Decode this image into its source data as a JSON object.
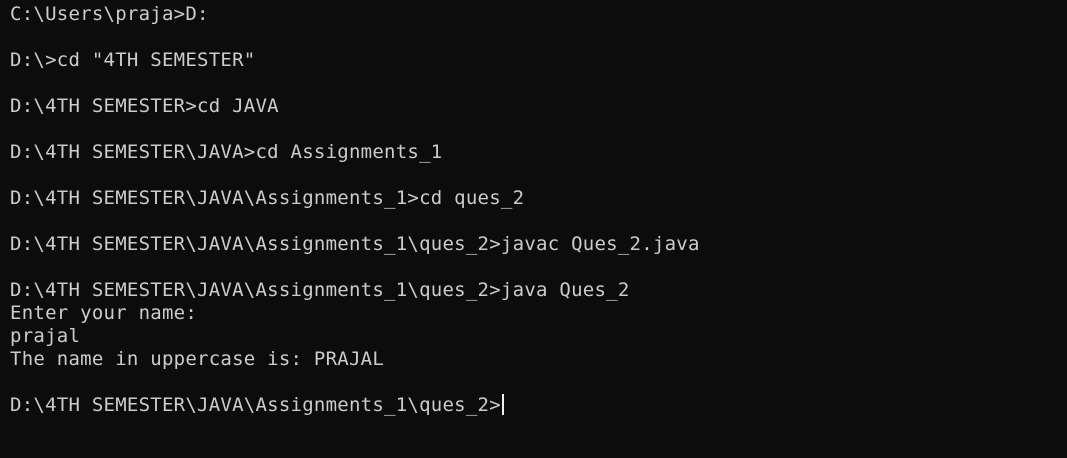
{
  "terminal": {
    "lines": [
      "C:\\Users\\praja>D:",
      "",
      "D:\\>cd \"4TH SEMESTER\"",
      "",
      "D:\\4TH SEMESTER>cd JAVA",
      "",
      "D:\\4TH SEMESTER\\JAVA>cd Assignments_1",
      "",
      "D:\\4TH SEMESTER\\JAVA\\Assignments_1>cd ques_2",
      "",
      "D:\\4TH SEMESTER\\JAVA\\Assignments_1\\ques_2>javac Ques_2.java",
      "",
      "D:\\4TH SEMESTER\\JAVA\\Assignments_1\\ques_2>java Ques_2",
      "Enter your name:",
      "prajal",
      "The name in uppercase is: PRAJAL",
      "",
      "D:\\4TH SEMESTER\\JAVA\\Assignments_1\\ques_2>"
    ],
    "colors": {
      "background": "#0c0c0c",
      "foreground": "#cccccc",
      "cursor": "#f0f0f0"
    }
  }
}
